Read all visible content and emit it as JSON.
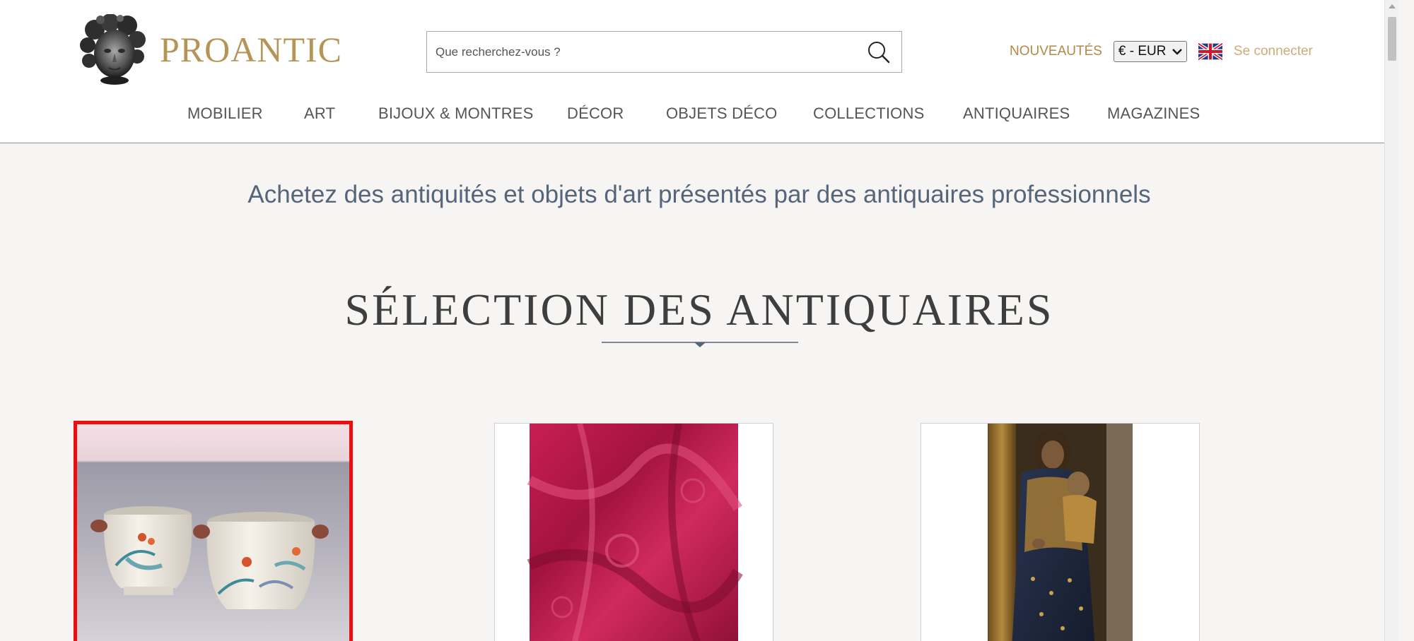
{
  "header": {
    "brand": "PROANTIC",
    "search": {
      "placeholder": "Que recherchez-vous ?"
    },
    "nouveautes": "NOUVEAUTÉS",
    "currency": "€ - EUR",
    "signin": "Se connecter"
  },
  "nav": [
    "MOBILIER",
    "ART",
    "BIJOUX & MONTRES",
    "DÉCOR",
    "OBJETS DÉCO",
    "COLLECTIONS",
    "ANTIQUAIRES",
    "MAGAZINES"
  ],
  "main": {
    "tagline": "Achetez des antiquités et objets d'art présentés par des antiquaires professionnels",
    "section_title": "SÉLECTION DES ANTIQUAIRES",
    "products": [
      {
        "icon": "porcelain-pots-image",
        "selected": true
      },
      {
        "icon": "red-silk-fabric-image",
        "selected": false
      },
      {
        "icon": "madonna-statue-image",
        "selected": false
      }
    ]
  },
  "colors": {
    "brand_gold": "#b59455",
    "nav_text": "#555555",
    "tagline": "#56657a",
    "selection_outline": "#ee0d0d",
    "page_bg": "#f6f5f3"
  }
}
